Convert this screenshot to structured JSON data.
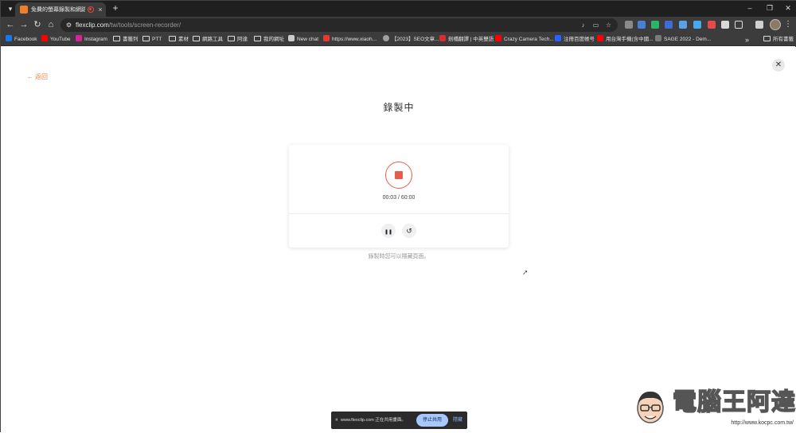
{
  "browser": {
    "tab": {
      "title": "免費的螢幕錄製和網路攝",
      "close_glyph": "×"
    },
    "new_tab_glyph": "+",
    "window_controls": {
      "minimize": "–",
      "restore": "❐",
      "close": "✕"
    },
    "nav": {
      "back": "←",
      "forward": "→",
      "reload": "↻",
      "home": "⌂"
    },
    "address": {
      "host": "flexclip.com",
      "path": "/tw/tools/screen-recorder/"
    },
    "bookmarks": [
      {
        "label": "Facebook",
        "kind": "site",
        "color": "#1877f2"
      },
      {
        "label": "YouTube",
        "kind": "site",
        "color": "#ff0000"
      },
      {
        "label": "Instagram",
        "kind": "site",
        "color": "#d6249f"
      },
      {
        "label": "書籤列",
        "kind": "folder"
      },
      {
        "label": "PTT",
        "kind": "folder"
      },
      {
        "label": "素材",
        "kind": "folder"
      },
      {
        "label": "網路工具",
        "kind": "folder"
      },
      {
        "label": "阿達",
        "kind": "folder"
      },
      {
        "label": "我的網址",
        "kind": "folder"
      },
      {
        "label": "New chat",
        "kind": "site",
        "color": "#cccccc"
      },
      {
        "label": "https://www.xiaoh...",
        "kind": "site",
        "color": "#e53935"
      },
      {
        "label": "【2023】SEO文章...",
        "kind": "site",
        "color": "#9e9e9e"
      },
      {
        "label": "劍橋翻譯 | 中英雙語",
        "kind": "site",
        "color": "#d32f2f"
      },
      {
        "label": "Crazy Camera Tech...",
        "kind": "site",
        "color": "#ff0000"
      },
      {
        "label": "注冊百度帳号",
        "kind": "site",
        "color": "#2962ff"
      },
      {
        "label": "用台灣手機(含中國...",
        "kind": "site",
        "color": "#ff0000"
      },
      {
        "label": "SAGE 2022 - Dem...",
        "kind": "site",
        "color": "#7a7a7a"
      }
    ],
    "bookmarks_overflow": "»",
    "all_bookmarks": "所有書籤"
  },
  "page": {
    "back_label": "返回",
    "close_glyph": "✕",
    "heading": "錄製中",
    "timer": "00:03 / 60:00",
    "pause_glyph": "❚❚",
    "restart_glyph": "↺",
    "hint": "錄製時您可以隱藏頁面。"
  },
  "share_bar": {
    "grip": "⏸",
    "text": "www.flexclip.com 正在共用畫面。",
    "stop_label": "停止共用",
    "hide_label": "隱藏"
  },
  "watermark": {
    "title": "電腦王阿達",
    "url": "http://www.kocpc.com.tw/"
  },
  "colors": {
    "accent": "#e65d4a",
    "back_link": "#f0824a",
    "chrome_dark": "#1f1f1f",
    "chrome_bar": "#3c3c3c"
  }
}
